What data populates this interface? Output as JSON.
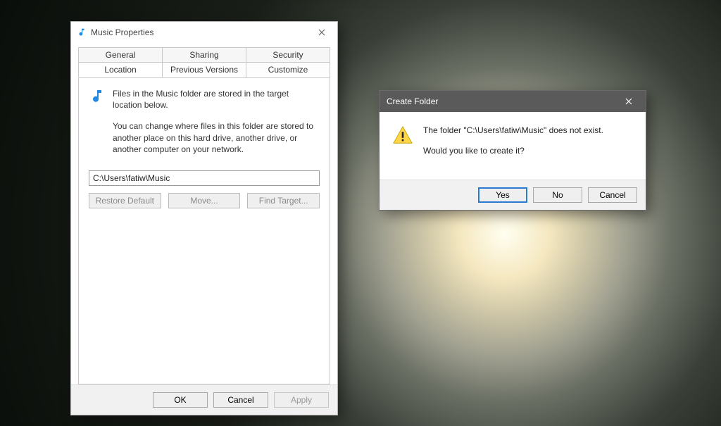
{
  "properties": {
    "title": "Music Properties",
    "tabs_row1": [
      "General",
      "Sharing",
      "Security"
    ],
    "tabs_row2": [
      "Location",
      "Previous Versions",
      "Customize"
    ],
    "active_tab": "Location",
    "location": {
      "intro": "Files in the Music folder are stored in the target location below.",
      "explain": "You can change where files in this folder are stored to another place on this hard drive, another drive, or another computer on your network.",
      "path": "C:\\Users\\fatiw\\Music",
      "buttons": {
        "restore": "Restore Default",
        "move": "Move...",
        "find": "Find Target..."
      }
    },
    "footer": {
      "ok": "OK",
      "cancel": "Cancel",
      "apply": "Apply"
    }
  },
  "confirm": {
    "title": "Create Folder",
    "line1": "The folder \"C:\\Users\\fatiw\\Music\" does not exist.",
    "line2": "Would you like to create it?",
    "buttons": {
      "yes": "Yes",
      "no": "No",
      "cancel": "Cancel"
    }
  }
}
